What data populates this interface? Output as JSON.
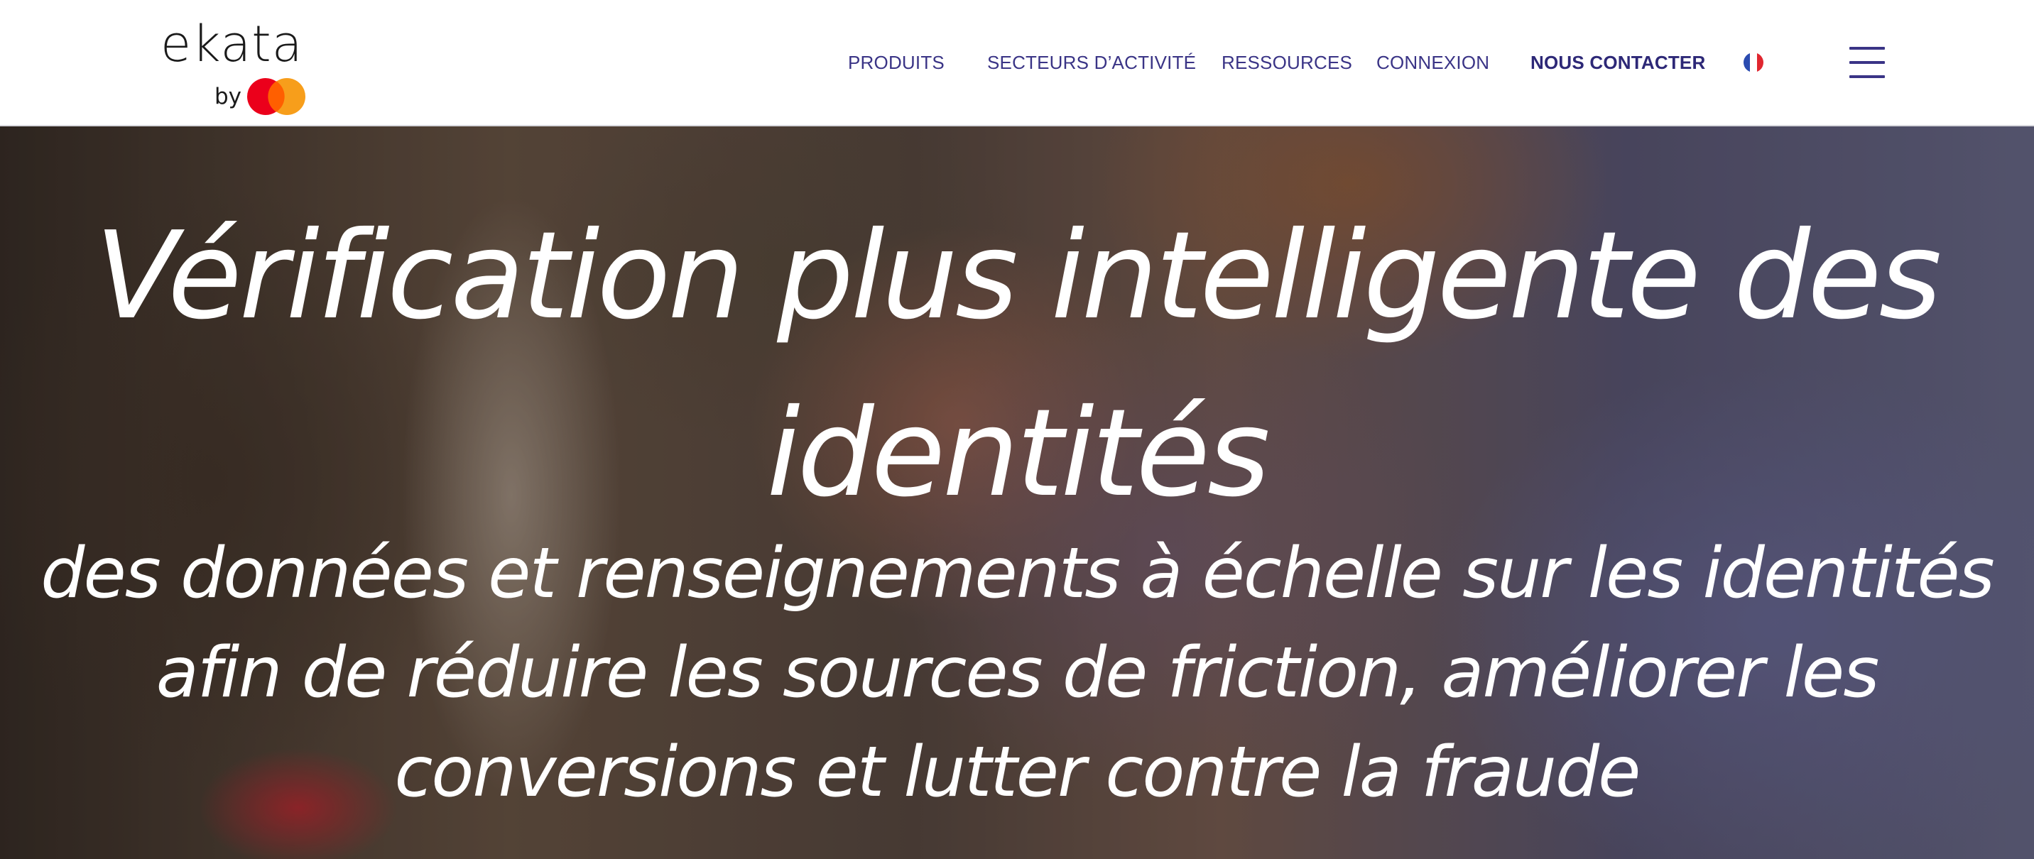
{
  "header": {
    "logo": {
      "wordmark": "ekata",
      "by_label": "by",
      "partner_icon": "mastercard-logo-icon",
      "colors": {
        "red": "#eb001b",
        "yellow": "#f79e1b",
        "overlap": "#ff5f00"
      }
    },
    "nav": {
      "items": [
        {
          "label": "PRODUITS"
        },
        {
          "label": "SECTEURS D’ACTIVITÉ"
        },
        {
          "label": "RESSOURCES"
        },
        {
          "label": "CONNEXION"
        },
        {
          "label": "NOUS CONTACTER"
        }
      ],
      "language_icon": "french-flag-icon",
      "menu_icon": "hamburger-menu-icon"
    },
    "accent_color": "#3a3486"
  },
  "hero": {
    "title": "Vérification plus intelligente des identités",
    "subtitle": "des données et renseignements à échelle sur les identités afin de réduire les sources de friction, améliorer les conversions et lutter contre la fraude"
  }
}
